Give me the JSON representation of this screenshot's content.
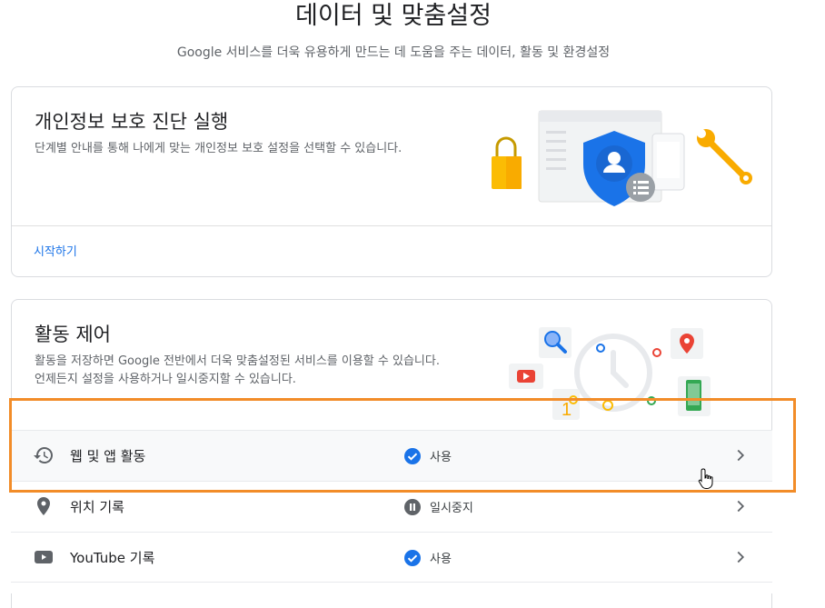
{
  "header": {
    "title": "데이터 및 맞춤설정",
    "subtitle": "Google 서비스를 더욱 유용하게 만드는 데 도움을 주는 데이터, 활동 및 환경설정"
  },
  "privacy_checkup": {
    "title": "개인정보 보호 진단 실행",
    "description": "단계별 안내를 통해 나에게 맞는 개인정보 보호 설정을 선택할 수 있습니다.",
    "link_label": "시작하기"
  },
  "activity_controls": {
    "title": "활동 제어",
    "description": "활동을 저장하면 Google 전반에서 더욱 맞춤설정된 서비스를 이용할 수 있습니다. 언제든지 설정을 사용하거나 일시중지할 수 있습니다.",
    "illustration_digit": "1",
    "rows": [
      {
        "label": "웹 및 앱 활동",
        "status": "사용",
        "icon": "history-icon",
        "status_icon": "check-circle-icon"
      },
      {
        "label": "위치 기록",
        "status": "일시중지",
        "icon": "location-pin-icon",
        "status_icon": "pause-circle-icon"
      },
      {
        "label": "YouTube 기록",
        "status": "사용",
        "icon": "youtube-icon",
        "status_icon": "check-circle-icon"
      }
    ]
  },
  "colors": {
    "accent_blue": "#1a73e8",
    "highlight_orange": "#f28c28",
    "status_on": "#1a73e8",
    "status_paused": "#5f6368"
  }
}
